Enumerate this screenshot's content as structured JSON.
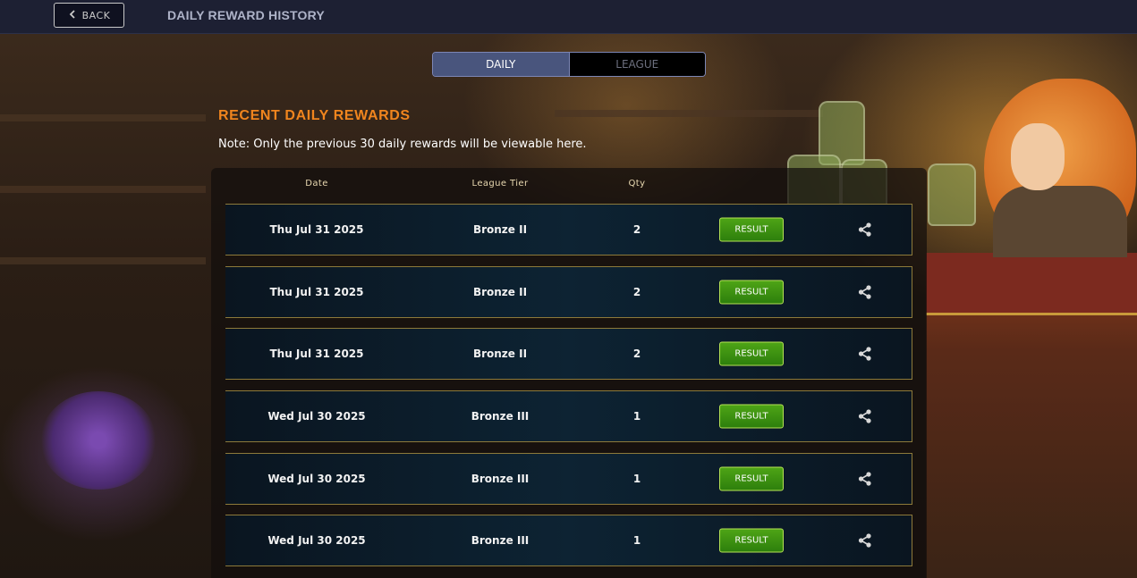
{
  "topbar": {
    "back_label": "BACK",
    "title": "DAILY REWARD HISTORY"
  },
  "tabs": [
    {
      "label": "DAILY",
      "active": true
    },
    {
      "label": "LEAGUE",
      "active": false
    }
  ],
  "section": {
    "title": "RECENT DAILY REWARDS",
    "note": "Note: Only the previous 30 daily rewards will be viewable here."
  },
  "table": {
    "headers": {
      "date": "Date",
      "tier": "League Tier",
      "qty": "Qty"
    },
    "rows": [
      {
        "date": "Thu Jul 31 2025",
        "tier": "Bronze II",
        "qty": "2",
        "action": "RESULT"
      },
      {
        "date": "Thu Jul 31 2025",
        "tier": "Bronze II",
        "qty": "2",
        "action": "RESULT"
      },
      {
        "date": "Thu Jul 31 2025",
        "tier": "Bronze II",
        "qty": "2",
        "action": "RESULT"
      },
      {
        "date": "Wed Jul 30 2025",
        "tier": "Bronze III",
        "qty": "1",
        "action": "RESULT"
      },
      {
        "date": "Wed Jul 30 2025",
        "tier": "Bronze III",
        "qty": "1",
        "action": "RESULT"
      },
      {
        "date": "Wed Jul 30 2025",
        "tier": "Bronze III",
        "qty": "1",
        "action": "RESULT"
      }
    ]
  },
  "icons": {
    "back": "chevron-left-icon",
    "share": "share-icon"
  },
  "colors": {
    "accent_orange": "#f0851e",
    "tab_active": "#49557d",
    "result_green": "#3a9010",
    "row_border": "#8d7a3a",
    "topbar": "#1d2033"
  }
}
